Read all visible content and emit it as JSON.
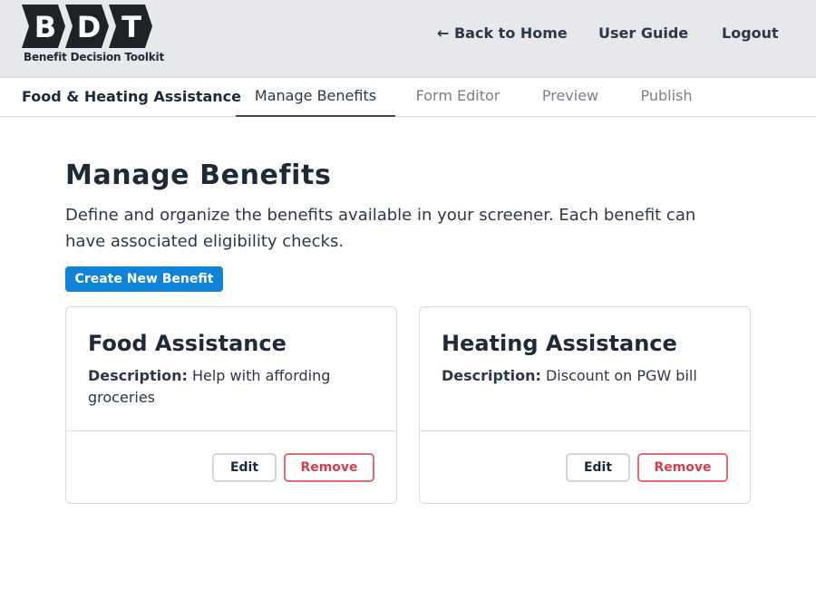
{
  "header": {
    "logo_letters": [
      "B",
      "D",
      "T"
    ],
    "logo_tagline": "Benefit Decision Toolkit",
    "nav": {
      "back_label": "← Back to Home",
      "guide_label": "User Guide",
      "logout_label": "Logout"
    }
  },
  "tabbar": {
    "project_title": "Food & Heating Assistance",
    "tabs": [
      {
        "label": "Manage Benefits",
        "active": true
      },
      {
        "label": "Form Editor",
        "active": false
      },
      {
        "label": "Preview",
        "active": false
      },
      {
        "label": "Publish",
        "active": false
      }
    ]
  },
  "main": {
    "title": "Manage Benefits",
    "description": "Define and organize the benefits available in your screener. Each benefit can have associated eligibility checks.",
    "create_label": "Create New Benefit",
    "benefits": [
      {
        "name": "Food Assistance",
        "description_label": "Description:",
        "description": "Help with affording groceries",
        "edit_label": "Edit",
        "remove_label": "Remove"
      },
      {
        "name": "Heating Assistance",
        "description_label": "Description:",
        "description": "Discount on PGW bill",
        "edit_label": "Edit",
        "remove_label": "Remove"
      }
    ]
  },
  "colors": {
    "header_bg": "#e6e8eb",
    "primary": "#0f83d6",
    "danger": "#d2404b",
    "logo_dark": "#1f2328"
  }
}
